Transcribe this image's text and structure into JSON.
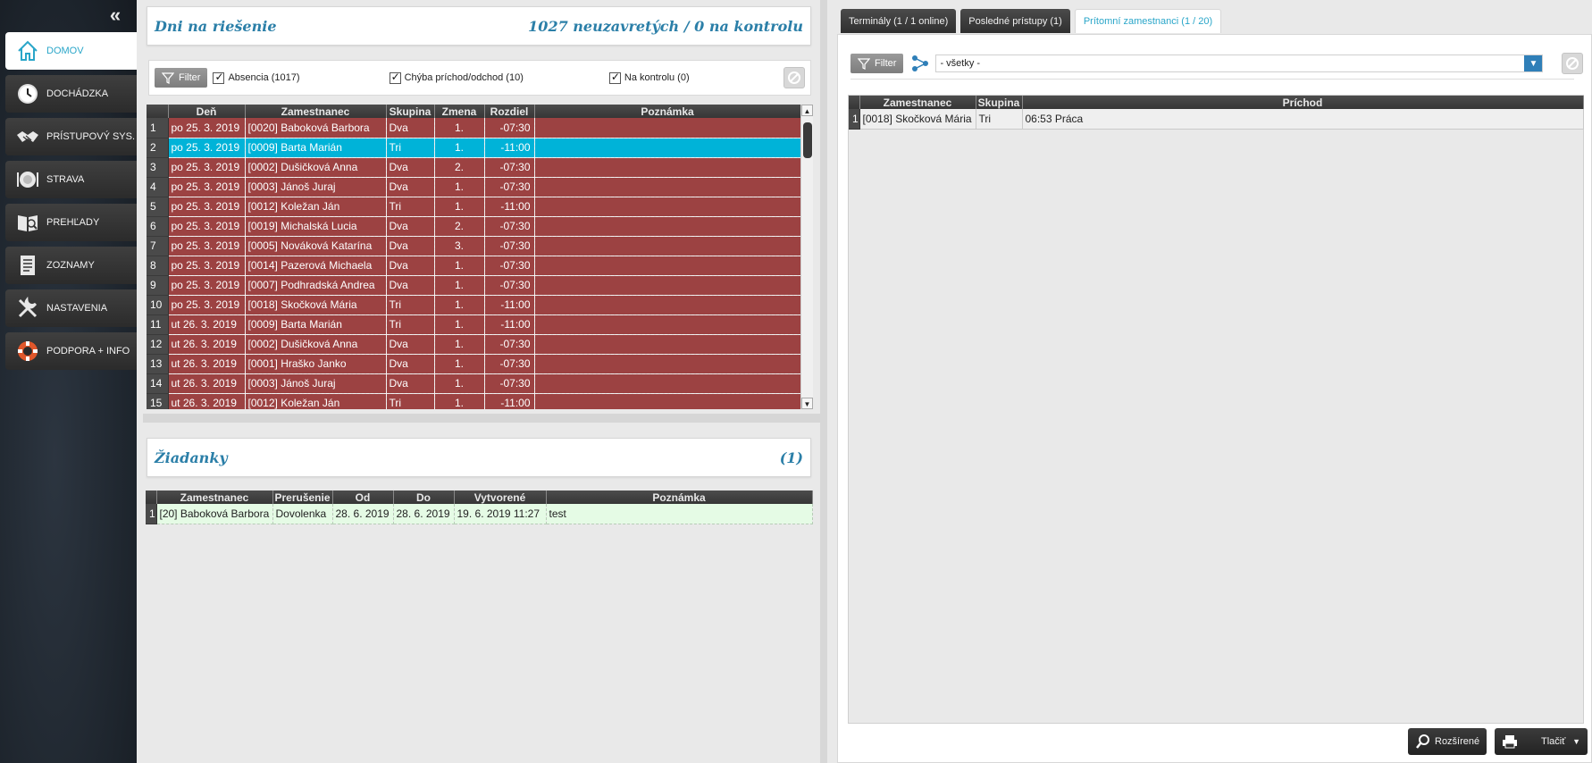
{
  "sidebar": {
    "collapse": "«",
    "items": [
      {
        "label": "DOMOV",
        "icon": "home-icon"
      },
      {
        "label": "DOCHÁDZKA",
        "icon": "clock-icon"
      },
      {
        "label": "PRÍSTUPOVÝ SYS.",
        "icon": "handshake-icon"
      },
      {
        "label": "STRAVA",
        "icon": "plate-icon"
      },
      {
        "label": "PREHĽADY",
        "icon": "report-icon"
      },
      {
        "label": "ZOZNAMY",
        "icon": "list-icon"
      },
      {
        "label": "NASTAVENIA",
        "icon": "wrench-icon"
      },
      {
        "label": "PODPORA + INFO",
        "icon": "lifebuoy-icon"
      }
    ]
  },
  "days": {
    "title": "Dni na riešenie",
    "summary": "1027 neuzavretých / 0 na kontrolu",
    "filter_label": "Filter",
    "checks": [
      "Absencia (1017)",
      "Chýba príchod/odchod (10)",
      "Na kontrolu (0)"
    ],
    "columns": [
      "",
      "Deň",
      "Zamestnanec",
      "Skupina",
      "Zmena",
      "Rozdiel",
      "Poznámka"
    ],
    "rows": [
      [
        "1",
        "po 25. 3. 2019",
        "[0020] Baboková Barbora",
        "Dva",
        "1.",
        "-07:30",
        ""
      ],
      [
        "2",
        "po 25. 3. 2019",
        "[0009] Barta Marián",
        "Tri",
        "1.",
        "-11:00",
        ""
      ],
      [
        "3",
        "po 25. 3. 2019",
        "[0002] Dušičková Anna",
        "Dva",
        "2.",
        "-07:30",
        ""
      ],
      [
        "4",
        "po 25. 3. 2019",
        "[0003] Jánoš Juraj",
        "Dva",
        "1.",
        "-07:30",
        ""
      ],
      [
        "5",
        "po 25. 3. 2019",
        "[0012] Koležan Ján",
        "Tri",
        "1.",
        "-11:00",
        ""
      ],
      [
        "6",
        "po 25. 3. 2019",
        "[0019] Michalská Lucia",
        "Dva",
        "2.",
        "-07:30",
        ""
      ],
      [
        "7",
        "po 25. 3. 2019",
        "[0005] Nováková Katarína",
        "Dva",
        "3.",
        "-07:30",
        ""
      ],
      [
        "8",
        "po 25. 3. 2019",
        "[0014] Pazerová Michaela",
        "Dva",
        "1.",
        "-07:30",
        ""
      ],
      [
        "9",
        "po 25. 3. 2019",
        "[0007] Podhradská Andrea",
        "Dva",
        "1.",
        "-07:30",
        ""
      ],
      [
        "10",
        "po 25. 3. 2019",
        "[0018] Skočková Mária",
        "Tri",
        "1.",
        "-11:00",
        ""
      ],
      [
        "11",
        "ut 26. 3. 2019",
        "[0009] Barta Marián",
        "Tri",
        "1.",
        "-11:00",
        ""
      ],
      [
        "12",
        "ut 26. 3. 2019",
        "[0002] Dušičková Anna",
        "Dva",
        "1.",
        "-07:30",
        ""
      ],
      [
        "13",
        "ut 26. 3. 2019",
        "[0001] Hraško Janko",
        "Dva",
        "1.",
        "-07:30",
        ""
      ],
      [
        "14",
        "ut 26. 3. 2019",
        "[0003] Jánoš Juraj",
        "Dva",
        "1.",
        "-07:30",
        ""
      ],
      [
        "15",
        "ut 26. 3. 2019",
        "[0012] Koležan Ján",
        "Tri",
        "1.",
        "-11:00",
        ""
      ]
    ],
    "selected_row": 1
  },
  "requests": {
    "title": "Žiadanky",
    "count": "(1)",
    "columns": [
      "",
      "Zamestnanec",
      "Prerušenie",
      "Od",
      "Do",
      "Vytvorené",
      "Poznámka"
    ],
    "rows": [
      [
        "1",
        "[20] Baboková Barbora",
        "Dovolenka",
        "28. 6. 2019",
        "28. 6. 2019",
        "19. 6. 2019  11:27",
        "test"
      ]
    ]
  },
  "right": {
    "tabs": [
      "Terminály (1 / 1 online)",
      "Posledné prístupy (1)",
      "Prítomní zamestnanci (1 / 20)"
    ],
    "active_tab": 2,
    "filter_label": "Filter",
    "select_value": "- všetky -",
    "columns": [
      "",
      "Zamestnanec",
      "Skupina",
      "Príchod"
    ],
    "rows": [
      [
        "1",
        "[0018] Skočková Mária",
        "Tri",
        "06:53 Práca"
      ]
    ],
    "btn_advanced": "Rozšírené",
    "btn_print": "Tlačiť"
  },
  "colors": {
    "accent": "#2aa6c9",
    "row_red": "#9c4242",
    "row_selected": "#00b3d8",
    "row_green": "#e5fbe5"
  }
}
